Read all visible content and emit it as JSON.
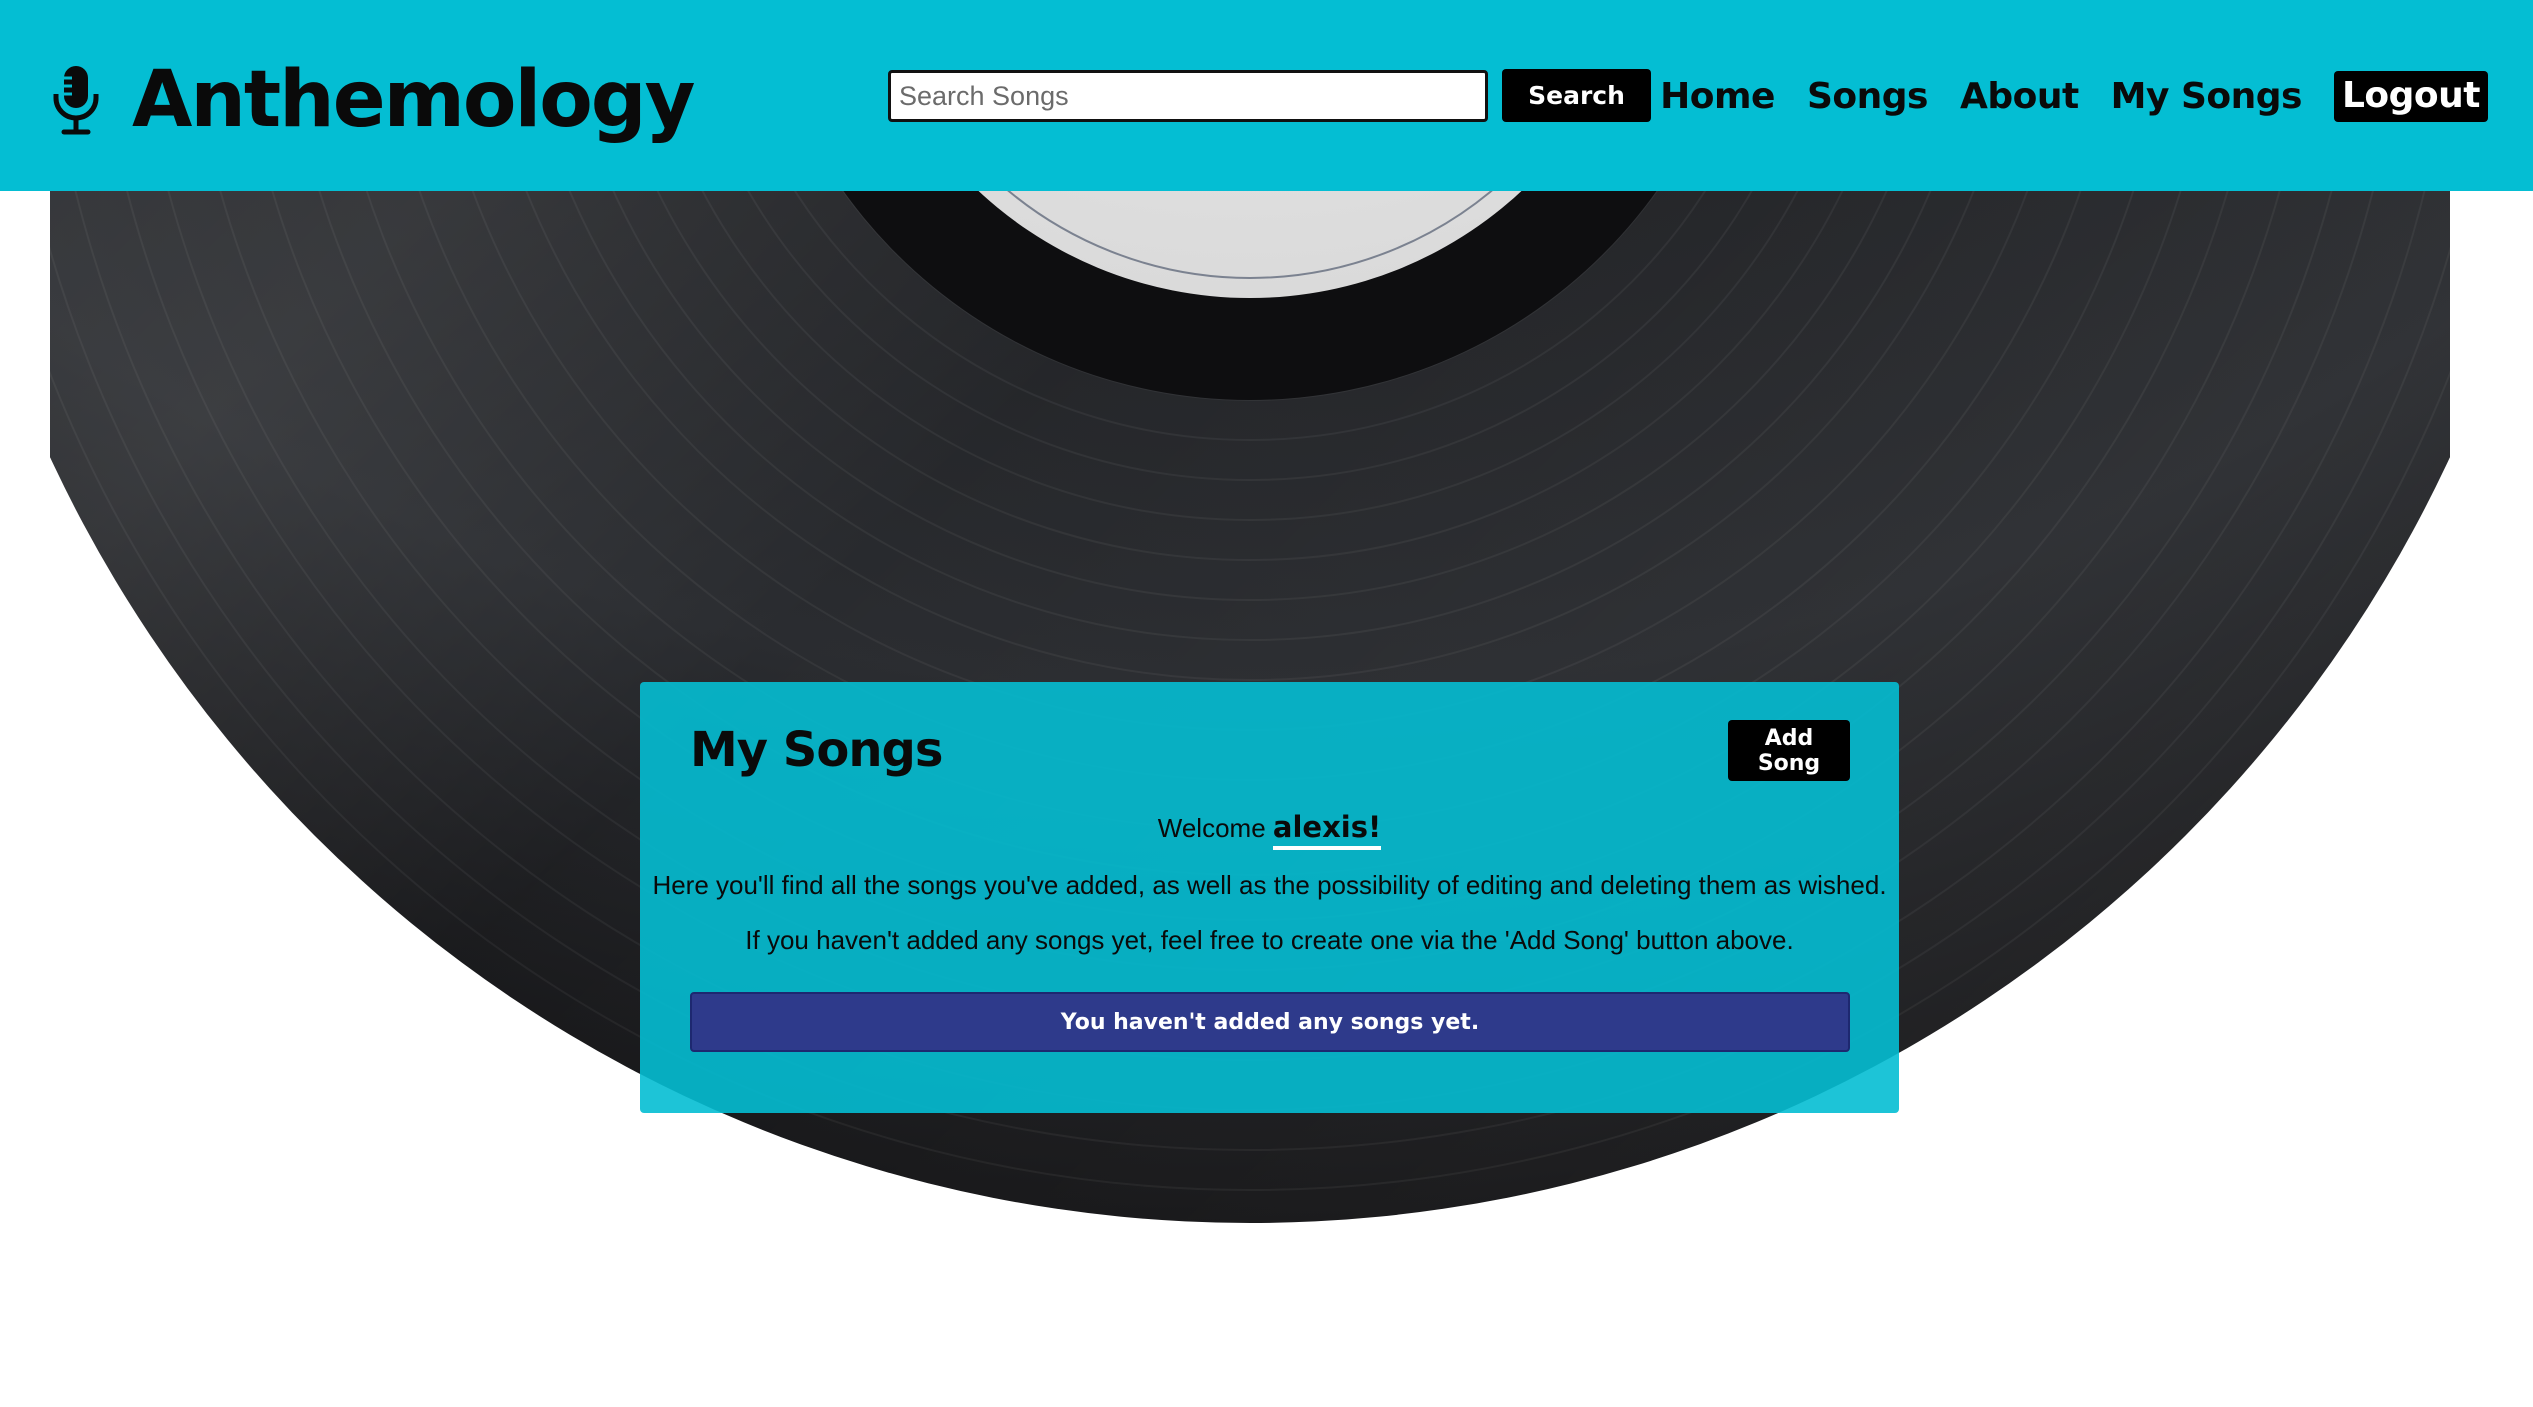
{
  "header": {
    "brand_name": "Anthemology",
    "brand_icon": "microphone-icon",
    "search": {
      "placeholder": "Search Songs",
      "value": "",
      "button_label": "Search"
    },
    "nav": {
      "home": "Home",
      "songs": "Songs",
      "about": "About",
      "my_songs": "My Songs",
      "logout": "Logout"
    }
  },
  "main": {
    "title": "My Songs",
    "add_song_label": "Add Song",
    "welcome_prefix": "Welcome",
    "username": "alexis!",
    "description_1": "Here you'll find all the songs you've added, as well as the possibility of editing and deleting them as wished.",
    "description_2": "If you haven't added any songs yet, feel free to create one via the 'Add Song' button above.",
    "empty_message": "You haven't added any songs yet."
  },
  "colors": {
    "header_bg": "#04bed3",
    "card_bg": "#04bed3",
    "alert_bg": "#2e3a8b",
    "button_bg": "#000000"
  }
}
